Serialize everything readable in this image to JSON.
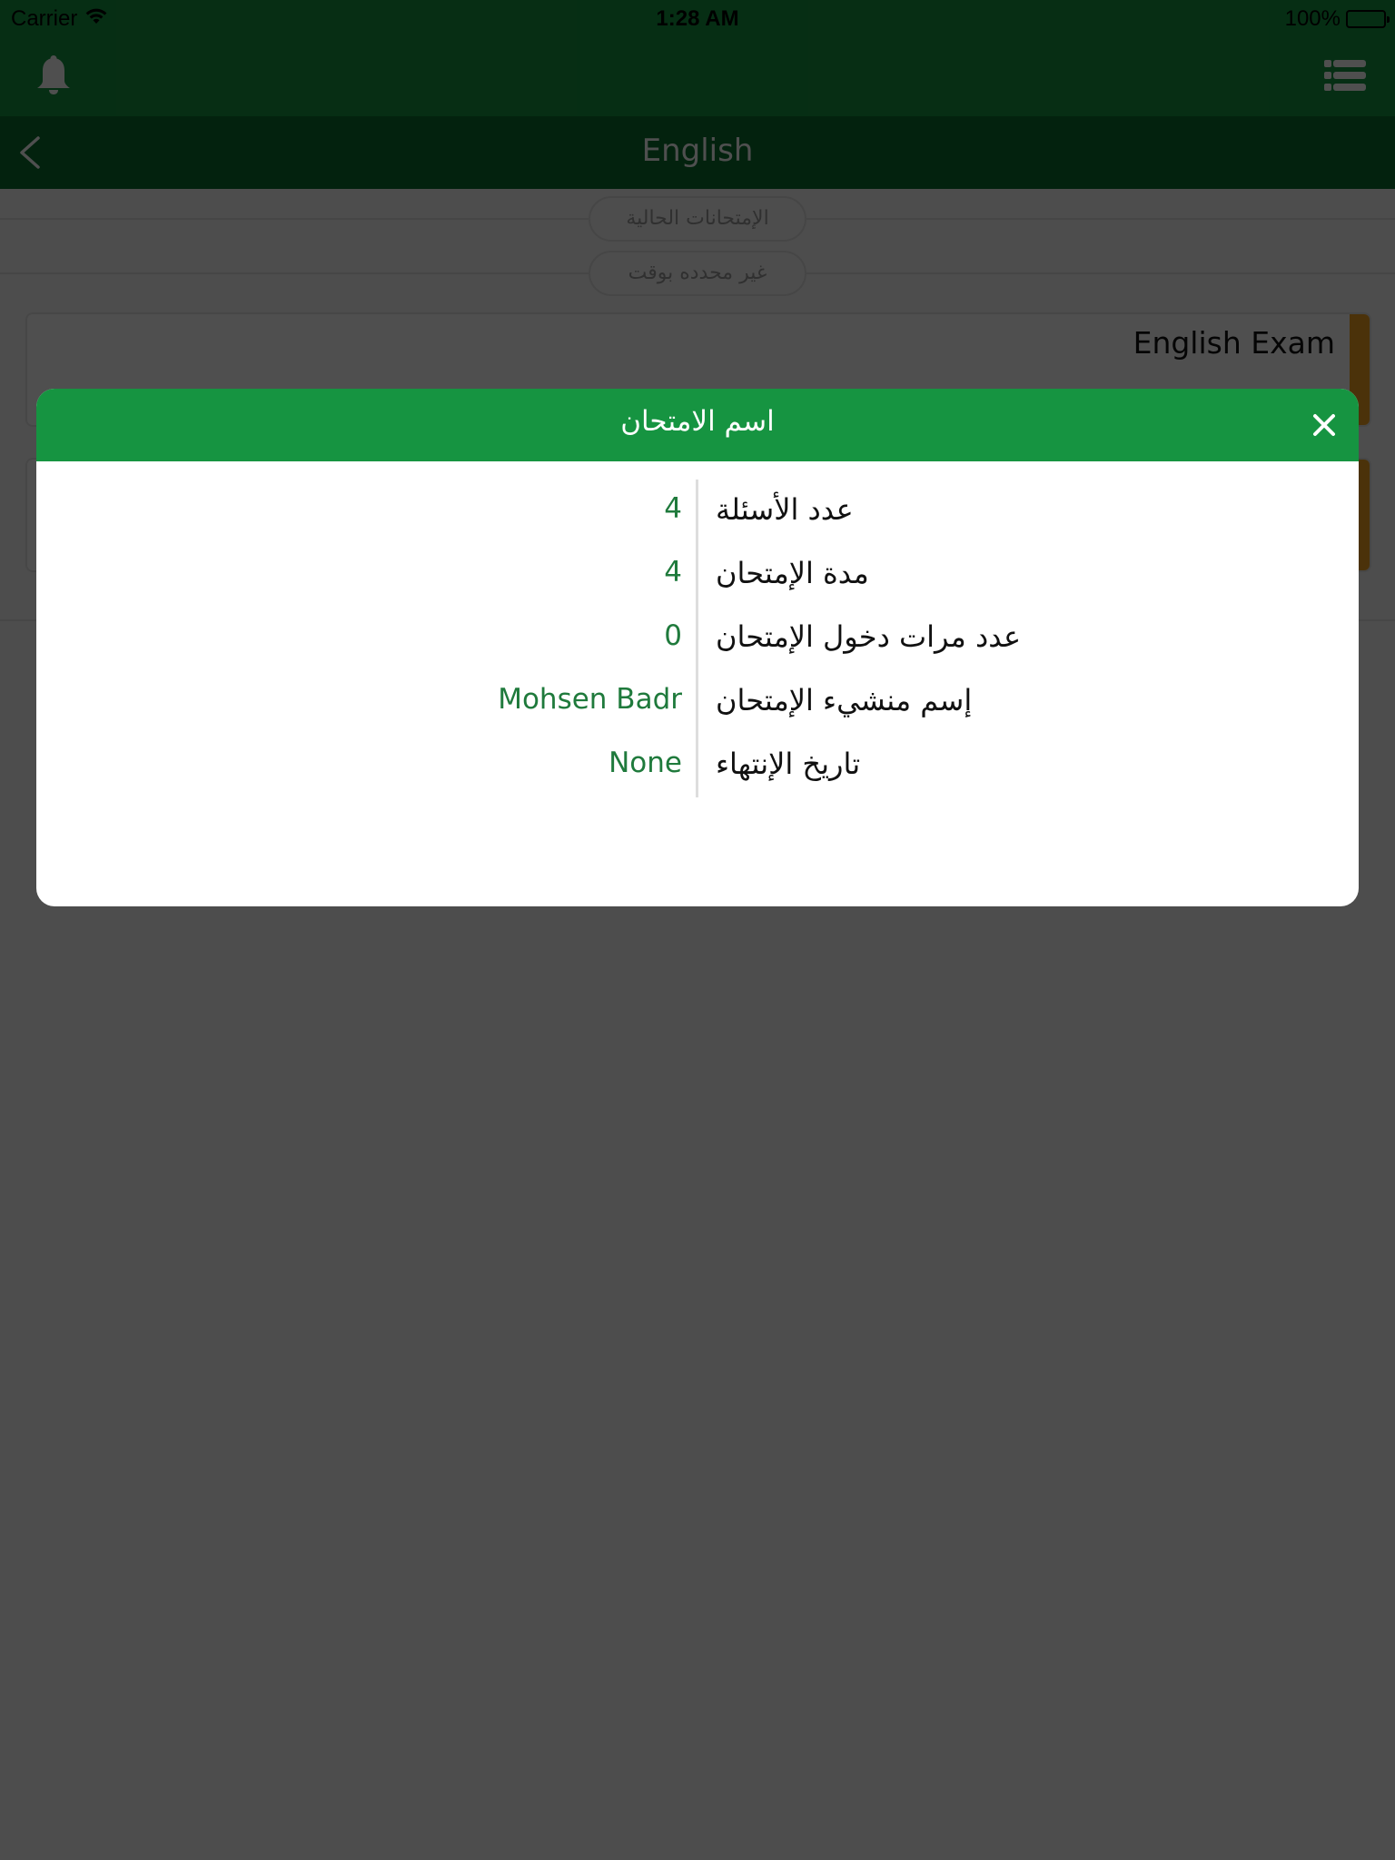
{
  "status_bar": {
    "carrier": "Carrier",
    "time": "1:28 AM",
    "battery": "100%",
    "icons": [
      "wifi-icon",
      "battery-icon"
    ]
  },
  "app_bar": {
    "left_icon": "bell-icon",
    "right_icon": "list-menu-icon"
  },
  "sub_header": {
    "back_icon": "chevron-left-icon",
    "title": "English"
  },
  "sections": [
    {
      "label": "الإمتحانات الحالية"
    },
    {
      "label": "غير محدده بوقت"
    }
  ],
  "exam_cards": [
    {
      "name": "English Exam"
    },
    {
      "name": ""
    }
  ],
  "modal": {
    "title": "اسم الامتحان",
    "close_icon": "close-icon",
    "rows": [
      {
        "label": "عدد الأسئلة",
        "value": "4"
      },
      {
        "label": "مدة الإمتحان",
        "value": "4"
      },
      {
        "label": "عدد مرات دخول الإمتحان",
        "value": "0"
      },
      {
        "label": "إسم منشيء الإمتحان",
        "value": "Mohsen Badr"
      },
      {
        "label": "تاريخ الإنتهاء",
        "value": "None"
      }
    ]
  },
  "colors": {
    "primary_green": "#169441",
    "dark_green": "#0a6e2e",
    "value_green": "#1f7a3c",
    "card_accent_orange": "#f2a322",
    "overlay": "rgba(0,0,0,0.69)"
  }
}
